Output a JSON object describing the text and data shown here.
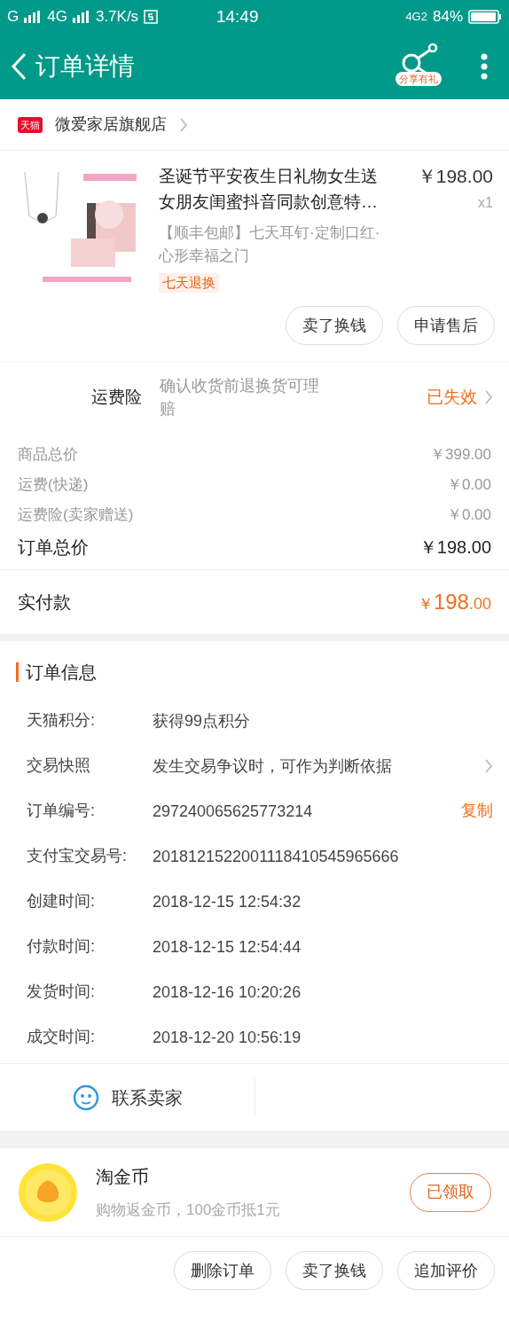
{
  "status_bar": {
    "left": [
      "G",
      "4G",
      "3.7K/s"
    ],
    "time": "14:49",
    "network": "4G2",
    "battery": "84%"
  },
  "header": {
    "title": "订单详情",
    "share_badge": "分享有礼"
  },
  "store": {
    "badge": "天猫",
    "name": "微爱家居旗舰店"
  },
  "product": {
    "title": "圣诞节平安夜生日礼物女生送女朋友闺蜜抖音同款创意特…",
    "sku": "【顺丰包邮】七天耳钉·定制口红·心形幸福之门",
    "tag": "七天退换",
    "price": "￥198.00",
    "quantity": "x1"
  },
  "product_actions": [
    "卖了换钱",
    "申请售后"
  ],
  "insurance": {
    "label": "运费险",
    "description": "确认收货前退换货可理赔",
    "status": "已失效"
  },
  "fees": [
    {
      "label": "商品总价",
      "value": "￥399.00"
    },
    {
      "label": "运费(快递)",
      "value": "￥0.00"
    },
    {
      "label": "运费险(卖家赠送)",
      "value": "￥0.00"
    }
  ],
  "order_total": {
    "label": "订单总价",
    "value": "￥198.00"
  },
  "paid": {
    "label": "实付款",
    "currency": "￥",
    "integer": "198",
    "decimal": ".00"
  },
  "order_info": {
    "title": "订单信息",
    "rows": [
      {
        "kind": "plain",
        "label": "天猫积分:",
        "value": "获得99点积分"
      },
      {
        "kind": "link",
        "label": "交易快照",
        "value": "发生交易争议时，可作为判断依据"
      },
      {
        "kind": "copy",
        "label": "订单编号:",
        "value": "297240065625773214",
        "action_text": "复制"
      },
      {
        "kind": "plain",
        "label": "支付宝交易号:",
        "value": "2018121522001118410545965666"
      },
      {
        "kind": "plain",
        "label": "创建时间:",
        "value": "2018-12-15 12:54:32"
      },
      {
        "kind": "plain",
        "label": "付款时间:",
        "value": "2018-12-15 12:54:44"
      },
      {
        "kind": "plain",
        "label": "发货时间:",
        "value": "2018-12-16 10:20:26"
      },
      {
        "kind": "plain",
        "label": "成交时间:",
        "value": "2018-12-20 10:56:19"
      }
    ]
  },
  "contact": {
    "label": "联系卖家"
  },
  "coins": {
    "title": "淘金币",
    "description": "购物返金币，100金币抵1元",
    "button": "已领取"
  },
  "bottom_actions": [
    "删除订单",
    "卖了换钱",
    "追加评价"
  ]
}
